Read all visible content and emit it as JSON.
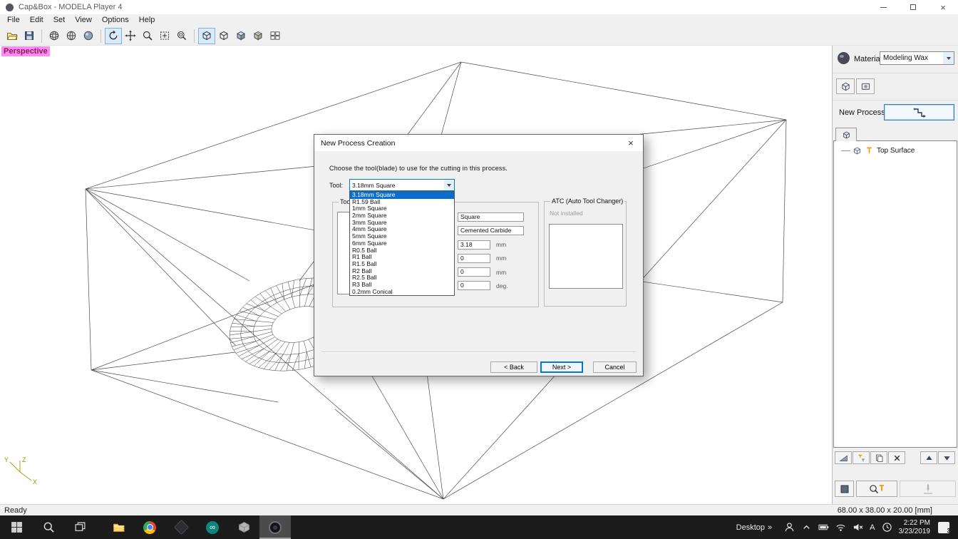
{
  "colors": {
    "accent": "#0078d7",
    "selection": "#0a6ed1",
    "perspective_bg": "#ff8af4",
    "perspective_text": "#94175e",
    "taskbar_bg": "#1c1c1c"
  },
  "titlebar": {
    "title": "Cap&Box - MODELA Player 4"
  },
  "menu": {
    "items": [
      "File",
      "Edit",
      "Set",
      "View",
      "Options",
      "Help"
    ]
  },
  "toolbar": {
    "icons": [
      "open-folder",
      "save",
      "wireframe-view",
      "hidden-line-view",
      "shaded-view",
      "rotate-view",
      "pan-view",
      "zoom-view",
      "fit-view",
      "zoom-region",
      "cube-wireframe",
      "cube-hidden-line",
      "cube-shaded",
      "cube-textured",
      "four-view-layout"
    ],
    "active": [
      "rotate-view",
      "cube-wireframe"
    ]
  },
  "viewport": {
    "label": "Perspective",
    "axes": {
      "x": "X",
      "y": "Y",
      "z": "Z"
    }
  },
  "dialog": {
    "title": "New Process Creation",
    "instruction": "Choose the tool(blade) to use for the cutting in this process.",
    "tool_label": "Tool:",
    "tool_value": "3.18mm Square",
    "dropdown_items": [
      "3.18mm Square",
      "R1.59 Ball",
      "1mm Square",
      "2mm Square",
      "3mm Square",
      "4mm Square",
      "5mm Square",
      "6mm Square",
      "R0.5 Ball",
      "R1 Ball",
      "R1.5 Ball",
      "R2 Ball",
      "R2.5 Ball",
      "R3 Ball",
      "0.2mm Conical"
    ],
    "selected_item": "3.18mm Square",
    "group_label": "Tool S",
    "spec_rows": [
      {
        "value": "Square",
        "unit": ""
      },
      {
        "value": "Cemented Carbide",
        "unit": ""
      },
      {
        "value": "3.18",
        "unit": "mm"
      },
      {
        "value": "0",
        "unit": "mm"
      },
      {
        "value": "0",
        "unit": "mm"
      },
      {
        "value": "0",
        "unit": "deg."
      }
    ],
    "atc": {
      "label": "ATC (Auto Tool Changer)",
      "status": "Not installed"
    },
    "buttons": {
      "back": "< Back",
      "next": "Next >",
      "cancel": "Cancel"
    }
  },
  "right_panel": {
    "material_label": "Material",
    "material_value": "Modeling Wax",
    "new_process_label": "New Process",
    "tree_items": [
      {
        "label": "Top Surface"
      }
    ]
  },
  "status": {
    "ready": "Ready",
    "dimensions": "68.00 x 38.00 x 20.00 [mm]"
  },
  "taskbar": {
    "desktop": "Desktop",
    "overflow": "»",
    "ime": "A",
    "time": "2:22 PM",
    "date": "3/23/2019",
    "notification_count": "3"
  }
}
